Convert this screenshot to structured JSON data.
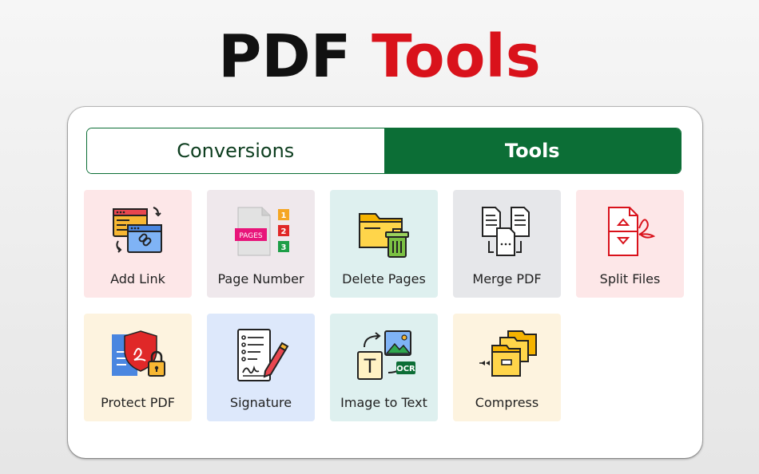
{
  "headline": {
    "word1": "PDF",
    "word2": "Tools"
  },
  "tabs": [
    {
      "label": "Conversions",
      "active": false
    },
    {
      "label": "Tools",
      "active": true
    }
  ],
  "tools": [
    {
      "label": "Add Link",
      "icon": "link-browser-icon",
      "bg": "#fde7e8"
    },
    {
      "label": "Page Number",
      "icon": "page-number-icon",
      "bg": "#efe8ec",
      "icon_text": "PAGES",
      "numbers": [
        "1",
        "2",
        "3"
      ]
    },
    {
      "label": "Delete Pages",
      "icon": "folder-trash-icon",
      "bg": "#def0ef"
    },
    {
      "label": "Merge PDF",
      "icon": "merge-documents-icon",
      "bg": "#e6e7ea"
    },
    {
      "label": "Split Files",
      "icon": "split-pdf-icon",
      "bg": "#fde7e8"
    },
    {
      "label": "Protect PDF",
      "icon": "shield-lock-icon",
      "bg": "#fdf3df"
    },
    {
      "label": "Signature",
      "icon": "signature-pen-icon",
      "bg": "#dde8fb"
    },
    {
      "label": "Image to Text",
      "icon": "ocr-icon",
      "bg": "#def0ef",
      "icon_text": "OCR"
    },
    {
      "label": "Compress",
      "icon": "compress-folder-icon",
      "bg": "#fdf3df"
    }
  ],
  "colors": {
    "brand_green": "#0c6e36",
    "accent_red": "#d9121b"
  }
}
